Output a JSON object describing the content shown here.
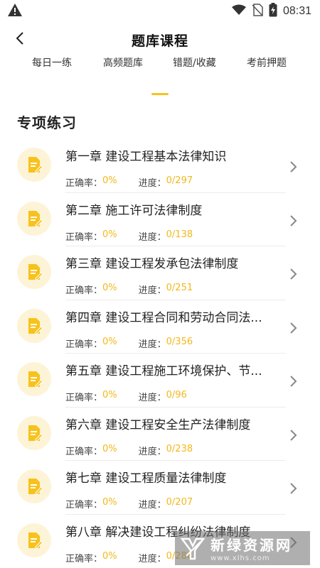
{
  "status_bar": {
    "time": "08:31"
  },
  "nav": {
    "title": "题库课程"
  },
  "tabs": [
    {
      "label": "每日一练"
    },
    {
      "label": "高频题库"
    },
    {
      "label": "错题/收藏"
    },
    {
      "label": "考前押题"
    }
  ],
  "section": {
    "title": "专项练习"
  },
  "chapters": [
    {
      "title": "第一章  建设工程基本法律知识",
      "accuracy_label": "正确率：",
      "accuracy": "0%",
      "progress_label": "进度：",
      "progress": "0/297"
    },
    {
      "title": "第二章  施工许可法律制度",
      "accuracy_label": "正确率：",
      "accuracy": "0%",
      "progress_label": "进度：",
      "progress": "0/138"
    },
    {
      "title": "第三章  建设工程发承包法律制度",
      "accuracy_label": "正确率：",
      "accuracy": "0%",
      "progress_label": "进度：",
      "progress": "0/251"
    },
    {
      "title": "第四章  建设工程合同和劳动合同法...",
      "accuracy_label": "正确率：",
      "accuracy": "0%",
      "progress_label": "进度：",
      "progress": "0/356"
    },
    {
      "title": "第五章  建设工程施工环境保护、节...",
      "accuracy_label": "正确率：",
      "accuracy": "0%",
      "progress_label": "进度：",
      "progress": "0/96"
    },
    {
      "title": "第六章  建设工程安全生产法律制度",
      "accuracy_label": "正确率：",
      "accuracy": "0%",
      "progress_label": "进度：",
      "progress": "0/238"
    },
    {
      "title": "第七章  建设工程质量法律制度",
      "accuracy_label": "正确率：",
      "accuracy": "0%",
      "progress_label": "进度：",
      "progress": "0/207"
    },
    {
      "title": "第八章  解决建设工程纠纷法律制度",
      "accuracy_label": "正确率：",
      "accuracy": "0%",
      "progress_label": "进度：",
      "progress": "0/288"
    }
  ],
  "watermark": {
    "name": "新绿资源网",
    "domain": "www.xlhs.com"
  },
  "colors": {
    "accent": "#f7c21b",
    "icon_bg": "#fdf3d7"
  }
}
